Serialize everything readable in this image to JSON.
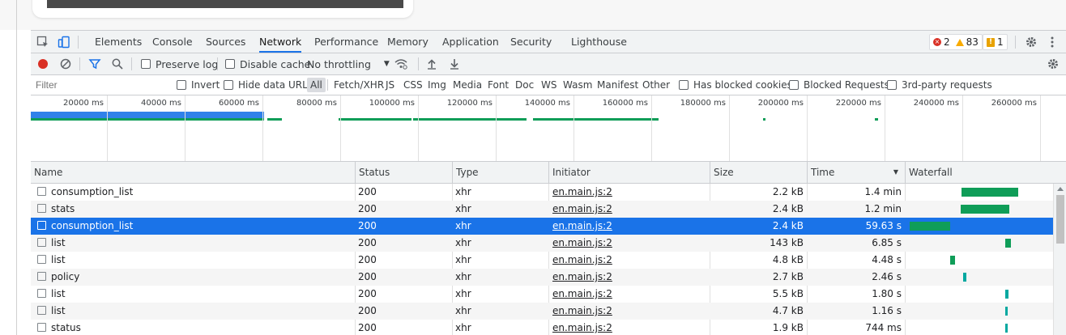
{
  "tabs": [
    "Elements",
    "Console",
    "Sources",
    "Network",
    "Performance",
    "Memory",
    "Application",
    "Security",
    "Lighthouse"
  ],
  "active_tab": "Network",
  "badges": {
    "errors": "2",
    "warnings": "83",
    "issues": "1"
  },
  "toolbar": {
    "preserve_log": "Preserve log",
    "disable_cache": "Disable cache",
    "throttling": "No throttling"
  },
  "filter": {
    "placeholder": "Filter",
    "invert": "Invert",
    "hide_data_urls": "Hide data URLs",
    "types": [
      "All",
      "Fetch/XHR",
      "JS",
      "CSS",
      "Img",
      "Media",
      "Font",
      "Doc",
      "WS",
      "Wasm",
      "Manifest",
      "Other"
    ],
    "has_blocked_cookies": "Has blocked cookies",
    "blocked_requests": "Blocked Requests",
    "third_party": "3rd-party requests"
  },
  "overview": {
    "ticks": [
      "20000 ms",
      "40000 ms",
      "60000 ms",
      "80000 ms",
      "100000 ms",
      "120000 ms",
      "140000 ms",
      "160000 ms",
      "180000 ms",
      "200000 ms",
      "220000 ms",
      "240000 ms",
      "260000 ms"
    ]
  },
  "columns": {
    "name": "Name",
    "status": "Status",
    "type": "Type",
    "initiator": "Initiator",
    "size": "Size",
    "time": "Time",
    "waterfall": "Waterfall"
  },
  "rows": [
    {
      "name": "consumption_list",
      "status": "200",
      "type": "xhr",
      "initiator": "en.main.js:2",
      "size": "2.2 kB",
      "time": "1.4 min"
    },
    {
      "name": "stats",
      "status": "200",
      "type": "xhr",
      "initiator": "en.main.js:2",
      "size": "2.4 kB",
      "time": "1.2 min"
    },
    {
      "name": "consumption_list",
      "status": "200",
      "type": "xhr",
      "initiator": "en.main.js:2",
      "size": "2.4 kB",
      "time": "59.63 s"
    },
    {
      "name": "list",
      "status": "200",
      "type": "xhr",
      "initiator": "en.main.js:2",
      "size": "143 kB",
      "time": "6.85 s"
    },
    {
      "name": "list",
      "status": "200",
      "type": "xhr",
      "initiator": "en.main.js:2",
      "size": "4.8 kB",
      "time": "4.48 s"
    },
    {
      "name": "policy",
      "status": "200",
      "type": "xhr",
      "initiator": "en.main.js:2",
      "size": "2.7 kB",
      "time": "2.46 s"
    },
    {
      "name": "list",
      "status": "200",
      "type": "xhr",
      "initiator": "en.main.js:2",
      "size": "5.5 kB",
      "time": "1.80 s"
    },
    {
      "name": "list",
      "status": "200",
      "type": "xhr",
      "initiator": "en.main.js:2",
      "size": "4.7 kB",
      "time": "1.16 s"
    },
    {
      "name": "status",
      "status": "200",
      "type": "xhr",
      "initiator": "en.main.js:2",
      "size": "1.9 kB",
      "time": "744 ms"
    }
  ],
  "selected_row": 2
}
